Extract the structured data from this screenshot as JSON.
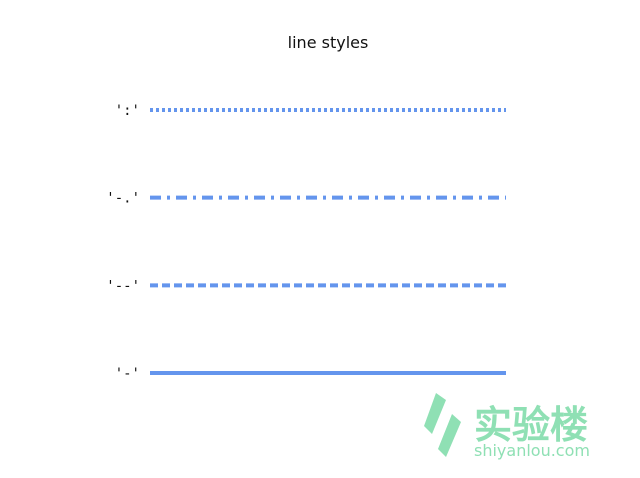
{
  "chart_data": {
    "type": "line",
    "title": "line styles",
    "xlabel": "",
    "ylabel": "",
    "grid": false,
    "axes_visible": false,
    "line_color": "#6495ED",
    "series": [
      {
        "linestyle": ":",
        "label": "':'",
        "y": 3
      },
      {
        "linestyle": "-.",
        "label": "'-.'",
        "y": 2
      },
      {
        "linestyle": "--",
        "label": "'--'",
        "y": 1
      },
      {
        "linestyle": "-",
        "label": "'-'",
        "y": 0
      }
    ]
  },
  "watermark": {
    "text_cn": "实验楼",
    "text_en": "shiyanlou.com",
    "color": "#8fe0b4"
  }
}
